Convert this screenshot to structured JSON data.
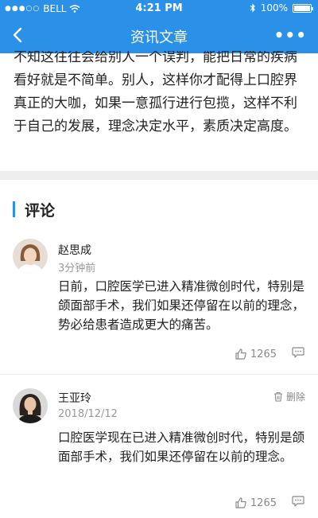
{
  "status_bar": {
    "carrier": "BELL",
    "time": "4:21 PM",
    "battery": "100%"
  },
  "nav": {
    "title": "资讯文章",
    "back_icon": "chevron-left-icon",
    "more_icon": "more-horizontal-icon"
  },
  "article": {
    "text": "不知这往往会给别人一个误判，能把日常的疾病看好就是不简单。别人，这样你才配得上口腔界真正的大咖，如果一意孤行进行包揽，这样不利于自己的发展，理念决定水平，素质决定高度。"
  },
  "comments_section": {
    "title": "评论",
    "comments": [
      {
        "name": "赵思成",
        "time": "3分钟前",
        "text": "日前，口腔医学已进入精准微创时代，特别是颌面部手术，我们如果还停留在以前的理念，势必给患者造成更大的痛苦。",
        "likes": "1265"
      },
      {
        "name": "王亚玲",
        "time": "2018/12/12",
        "text": "口腔医学现在已进入精准微创时代，特别是颌面部手术，我们如果还停留在以前的理念。",
        "likes": "1265",
        "delete_label": "删除"
      }
    ]
  },
  "colors": {
    "brand": "#2a90e8",
    "muted": "#999999"
  }
}
